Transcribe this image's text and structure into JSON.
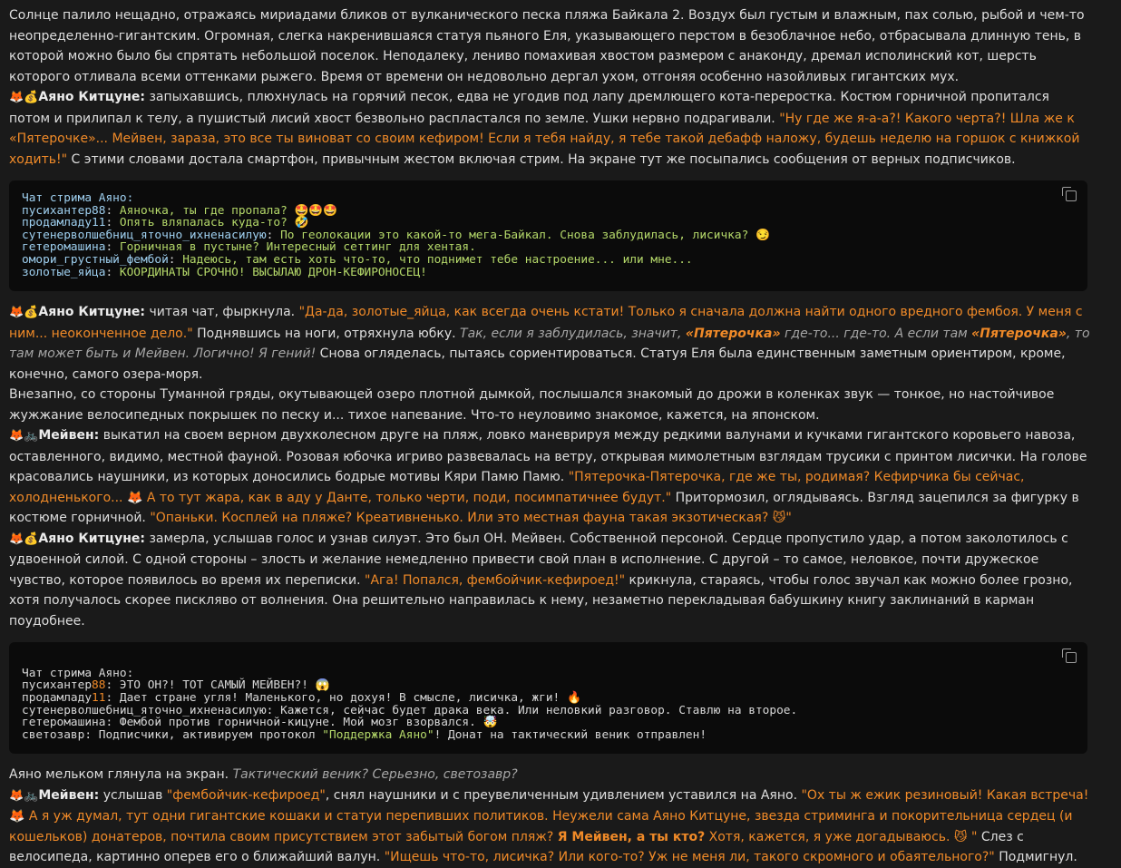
{
  "p1": "Солнце палило нещадно, отражаясь мириадами бликов от вулканического песка пляжа Байкала 2. Воздух был густым и влажным, пах солью, рыбой и чем-то неопределенно-гигантским. Огромная, слегка накренившаяся статуя пьяного Еля, указывающего перстом в безоблачное небо, отбрасывала длинную тень, в которой можно было бы спрятать небольшой поселок. Неподалеку, лениво помахивая хвостом размером с анаконду, дремал исполинский кот, шерсть которого отливала всеми оттенками рыжего. Время от времени он недовольно дергал ухом, отгоняя особенно назойливых гигантских мух.",
  "ayano": {
    "icons": "🦊💰",
    "name": "Аяно Китцуне:"
  },
  "meiven": {
    "icons": "🦊🚲",
    "name": "Мейвен:"
  },
  "p2": {
    "a": " запыхавшись, плюхнулась на горячий песок, едва не угодив под лапу дремлющего кота-переростка. Костюм горничной пропитался потом и прилипал к телу, а пушистый лисий хвост безвольно распластался по земле. Ушки нервно подрагивали. ",
    "q": "\"Ну где же я-а-а?! Какого черта?! Шла же к «Пятерочке»... Мейвен, зараза, это все ты виноват со своим кефиром! Если я тебя найду, я тебе такой дебафф наложу, будешь неделю на горшок с книжкой ходить!\"",
    "b": " С этими словами достала смартфон, привычным жестом включая стрим. На экране тут же посыпались сообщения от верных подписчиков."
  },
  "chat1": {
    "title": "Чат стрима Аяно:",
    "rows": [
      {
        "user": "пусихантер88",
        "msg": "Аяночка, ты где пропала? 🤩🤩🤩"
      },
      {
        "user": "продамладу11",
        "msg": "Опять вляпалась куда-то? 🤣"
      },
      {
        "user": "сутенерволшебниц_яточно_ихненасилую",
        "msg": "По геолокации это какой-то мега-Байкал. Снова заблудилась, лисичка? 😏"
      },
      {
        "user": "гетеромашина",
        "msg": "Горничная в пустыне? Интересный сеттинг для хентая."
      },
      {
        "user": "омори_грустный_фембой",
        "msg": "Надеюсь, там есть хоть что-то, что поднимет тебе настроение... или мне..."
      },
      {
        "user": "золотые_яйца",
        "msg": "КООРДИНАТЫ СРОЧНО! ВЫСЫЛАЮ ДРОН-КЕФИРОНОСЕЦ!"
      }
    ]
  },
  "p3": {
    "a": " читая чат, фыркнула. ",
    "q": "\"Да-да, золотые_яйца, как всегда очень кстати! Только я сначала должна найти одного вредного фембоя. У меня с ним... неоконченное дело.\"",
    "b": " Поднявшись на ноги, отряхнула юбку. ",
    "e1": "Так, если я заблудилась, значит, ",
    "e2": "«Пятерочка»",
    "e3": " где-то... где-то. А если там ",
    "e4": "«Пятерочка»",
    "e5": ", то там может быть и Мейвен. Логично! Я гений!",
    "c": " Снова огляделась, пытаясь сориентироваться. Статуя Еля была единственным заметным ориентиром, кроме, конечно, самого озера-моря."
  },
  "p4": "Внезапно, со стороны Туманной гряды, окутывающей озеро плотной дымкой, послышался знакомый до дрожи в коленках звук — тонкое, но настойчивое жужжание велосипедных покрышек по песку и... тихое напевание. Что-то неуловимо знакомое, кажется, на японском.",
  "p5": {
    "a": " выкатил на своем верном двухколесном друге на пляж, ловко маневрируя между редкими валунами и кучками гигантского коровьего навоза, оставленного, видимо, местной фауной. Розовая юбочка игриво развевалась на ветру, открывая мимолетным взглядам трусики с принтом лисички. На голове красовались наушники, из которых доносились бодрые мотивы Кяри Памю Памю. ",
    "q1": "\"Пятерочка-Пятерочка, где же ты, родимая? Кефирчика бы сейчас, холодненького... 🦊 А то тут жара, как в аду у Данте, только черти, поди, посимпатичнее будут.\"",
    "b": " Притормозил, оглядываясь. Взгляд зацепился за фигурку в костюме горничной. ",
    "q2": "\"Опаньки. Косплей на пляже? Креативненько. Или это местная фауна такая экзотическая? 😼\""
  },
  "p6": {
    "a": " замерла, услышав голос и узнав силуэт. Это был ОН. Мейвен. Собственной персоной. Сердце пропустило удар, а потом заколотилось с удвоенной силой. С одной стороны – злость и желание немедленно привести свой план в исполнение. С другой – то самое, неловкое, почти дружеское чувство, которое появилось во время их переписки. ",
    "q": "\"Ага! Попался, фембойчик-кефироед!\"",
    "b": " крикнула, стараясь, чтобы голос звучал как можно более грозно, хотя получалось скорее пискляво от волнения. Она решительно направилась к нему, незаметно перекладывая бабушкину книгу заклинаний в карман поудобнее."
  },
  "chat2": {
    "title": "Чат стрима Аяно:",
    "rows": [
      {
        "u1": "пусихантер",
        "n": "88",
        "msg": ": ЭТО ОН?! ТОТ САМЫЙ МЕЙВЕН?! 😱"
      },
      {
        "u1": "продамладу",
        "n": "11",
        "msg": ": Дает стране угля! Маленького, но дохуя! В смысле, лисичка, жги! 🔥"
      },
      {
        "u1": "сутенерволшебниц_яточно_ихненасилую",
        "n": "",
        "msg": ": Кажется, сейчас будет драка века. Или неловкий разговор. Ставлю на второе."
      },
      {
        "u1": "гетеромашина",
        "n": "",
        "msg": ": Фембой против горничной-кицуне. Мой мозг взорвался. 🤯"
      }
    ],
    "last": {
      "a": "светозавр: Подписчики, активируем протокол ",
      "s": "\"Поддержка Аяно\"",
      "b": "! Донат на тактический веник отправлен!"
    }
  },
  "p7": {
    "a": "Аяно мельком глянула на экран. ",
    "e": "Тактический веник? Серьезно, светозавр?"
  },
  "p8": {
    "a": " услышав ",
    "q1": "\"фембойчик-кефироед\"",
    "b": ", снял наушники и с преувеличенным удивлением уставился на Аяно. ",
    "q2": "\"Ох ты ж ежик резиновый! Какая встреча! 🦊 А я уж думал, тут одни гигантские кошаки и статуи перепивших политиков. Неужели сама Аяно Китцуне, звезда стриминга и покорительница сердец (и кошельков) донатеров, почтила своим присутствием этот забытый богом пляж? ",
    "q3": "Я Мейвен, а ты кто?",
    "q4": " Хотя, кажется, я уже догадываюсь. 😼 \"",
    "c": " Слез с велосипеда, картинно оперев его о ближайший валун. ",
    "q5": "\"Ищешь что-то, лисичка? Или кого-то? Уж не меня ли, такого скромного и обаятельного?\"",
    "d": " Подмигнул."
  }
}
